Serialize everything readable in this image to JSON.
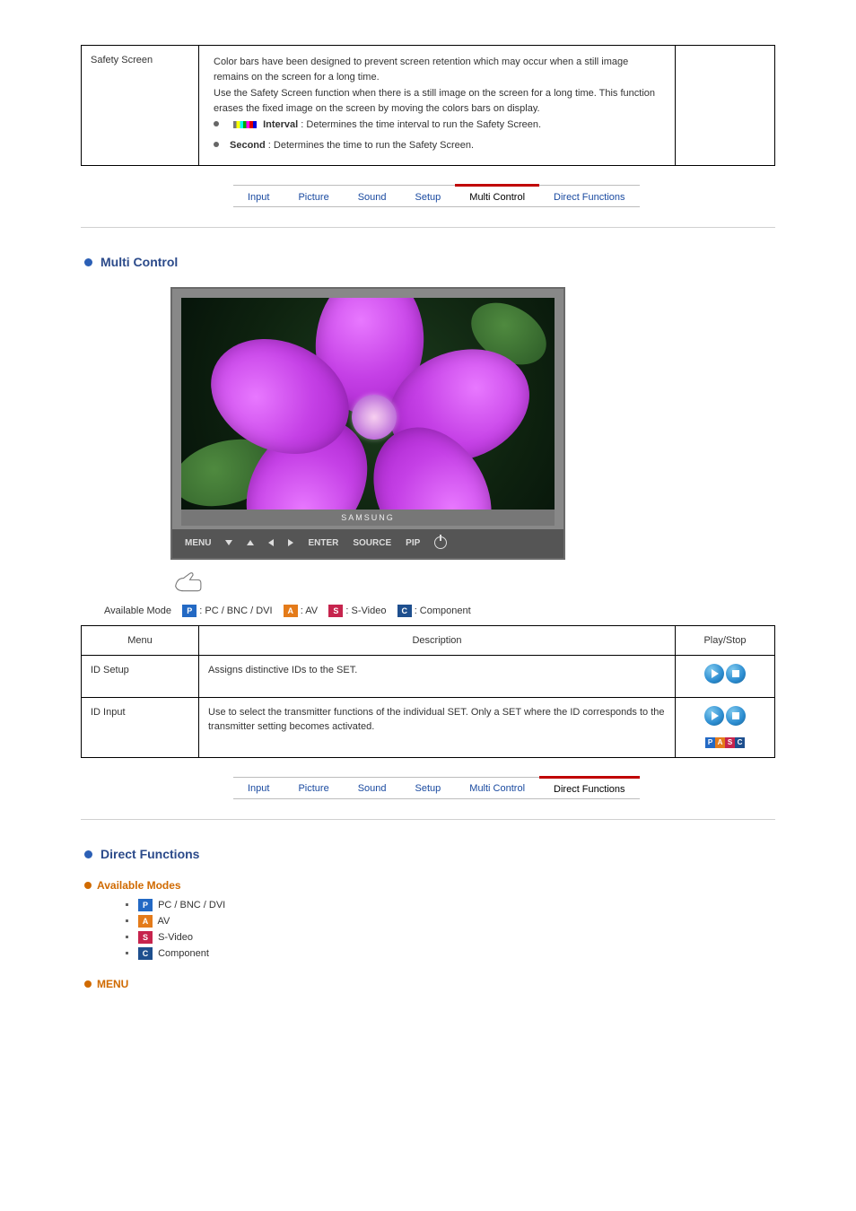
{
  "topTable": {
    "row": {
      "menuLabel": "Safety Screen",
      "lines": [
        "Color bars have been designed to prevent screen retention which may occur when a still image remains on the screen for a long time.",
        "Use the Safety Screen function when there is a still image on the screen for a long time. This function erases the fixed image on the screen by moving the colors bars on display.",
        ": Determines the time interval to run the Safety Screen.",
        ": Determines the time to run the Safety Screen."
      ],
      "intervalLabel": "Interval",
      "secondLabel": "Second"
    }
  },
  "tabs": [
    "Input",
    "Picture",
    "Sound",
    "Setup",
    "Multi Control",
    "Direct Functions"
  ],
  "activeTab1": 4,
  "activeTab2": 5,
  "section1": {
    "title": "Multi Control",
    "brand": "SAMSUNG",
    "buttons": [
      "MENU",
      "down",
      "up",
      "left",
      "right",
      "ENTER",
      "SOURCE",
      "PIP",
      "power"
    ],
    "modeLine": {
      "prefix": "Available Mode",
      "p": ": PC / BNC / DVI",
      "a": ": AV",
      "s": ": S-Video",
      "c": ": Component"
    },
    "table": {
      "headers": [
        "Menu",
        "Description",
        "Play/Stop"
      ],
      "rows": [
        {
          "menu": "ID Setup",
          "desc": "Assigns distinctive IDs to the SET."
        },
        {
          "menu": "ID Input",
          "desc": "Use to select the transmitter functions of the individual SET. Only a SET where the ID corresponds to the transmitter setting becomes activated."
        }
      ]
    }
  },
  "section2": {
    "title": "Direct Functions",
    "subhead1": "Available Modes",
    "modes": {
      "p": "PC / BNC / DVI",
      "a": "AV",
      "s": "S-Video",
      "c": "Component"
    },
    "subhead2": "MENU"
  }
}
